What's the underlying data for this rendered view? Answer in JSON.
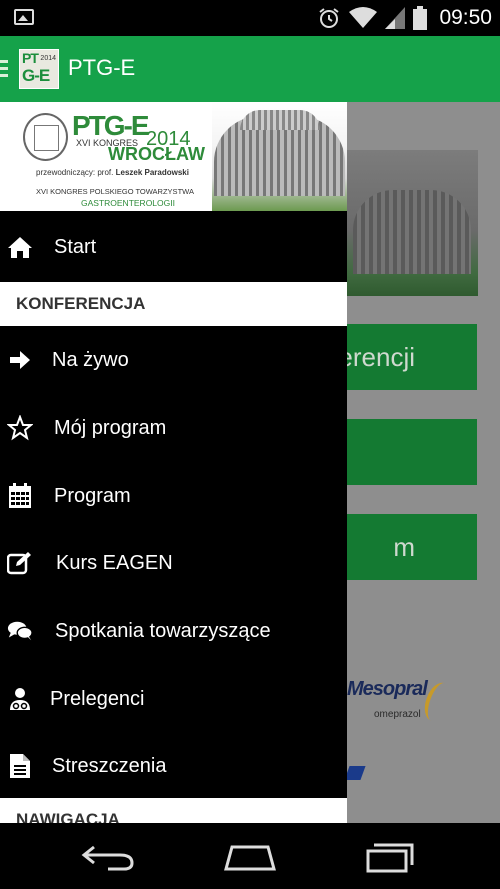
{
  "status_bar": {
    "time": "09:50",
    "icons": [
      "image-icon",
      "alarm-icon",
      "wifi-icon",
      "signal-icon",
      "battery-icon"
    ]
  },
  "app_bar": {
    "title": "PTG-E",
    "logo_text_top": "PT",
    "logo_text_bottom": "G-E",
    "logo_year": "2014"
  },
  "banner": {
    "logo_text": "PTG-E",
    "year": "2014",
    "kongres": "XVI KONGRES",
    "city": "WROCŁAW",
    "chair_prefix": "przewodniczący: prof.",
    "chair_name": "Leszek Paradowski",
    "society": "XVI KONGRES POLSKIEGO TOWARZYSTWA",
    "society_2": "GASTROENTEROLOGII"
  },
  "drawer": {
    "start_label": "Start",
    "section_conference": "KONFERENCJA",
    "items": [
      {
        "label": "Na żywo",
        "icon": "arrow-right-icon"
      },
      {
        "label": "Mój program",
        "icon": "star-icon"
      },
      {
        "label": "Program",
        "icon": "calendar-icon"
      },
      {
        "label": "Kurs EAGEN",
        "icon": "edit-icon"
      },
      {
        "label": "Spotkania towarzyszące",
        "icon": "chat-icon"
      },
      {
        "label": "Prelegenci",
        "icon": "user-doctor-icon"
      },
      {
        "label": "Streszczenia",
        "icon": "document-icon"
      }
    ],
    "section_navigation": "NAWIGACJA"
  },
  "background": {
    "button_1": "erencji",
    "button_3": "m",
    "sponsor_name": "Mesopral",
    "sponsor_sub": "omeprazol"
  },
  "colors": {
    "app_bar": "#15a24a",
    "drawer_bg": "#000000",
    "section_bg": "#ffffff",
    "bg_button": "#147a32"
  }
}
